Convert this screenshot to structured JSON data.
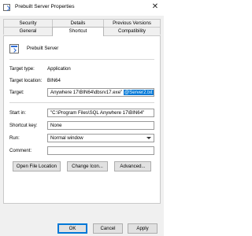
{
  "window": {
    "title": "Prebuilt Server Properties",
    "close_glyph": "✕"
  },
  "tabs": {
    "row1": [
      {
        "label": "Security"
      },
      {
        "label": "Details"
      },
      {
        "label": "Previous Versions"
      }
    ],
    "row2": [
      {
        "label": "General"
      },
      {
        "label": "Shortcut",
        "active": true
      },
      {
        "label": "Compatibility"
      }
    ]
  },
  "shortcut": {
    "name": "Prebuilt Server",
    "target_type_label": "Target type:",
    "target_type_value": "Application",
    "target_location_label": "Target location:",
    "target_location_value": "BIN64",
    "target_label": "Target:",
    "target_value_prefix": "Anywhere 17\\BIN64\\dbsrv17.exe\" ",
    "target_value_selected": "@Server2.txt",
    "start_in_label": "Start in:",
    "start_in_value": "\"C:\\Program Files\\SQL Anywhere 17\\BIN64\"",
    "shortcut_key_label": "Shortcut key:",
    "shortcut_key_value": "None",
    "run_label": "Run:",
    "run_value": "Normal window",
    "comment_label": "Comment:",
    "comment_value": ""
  },
  "buttons": {
    "open_file_location": "Open File Location",
    "change_icon": "Change Icon...",
    "advanced": "Advanced...",
    "ok": "OK",
    "cancel": "Cancel",
    "apply": "Apply"
  },
  "colors": {
    "selection": "#0078d7",
    "panel_bg": "#ffffff",
    "dialog_bg": "#f0f0f0"
  }
}
